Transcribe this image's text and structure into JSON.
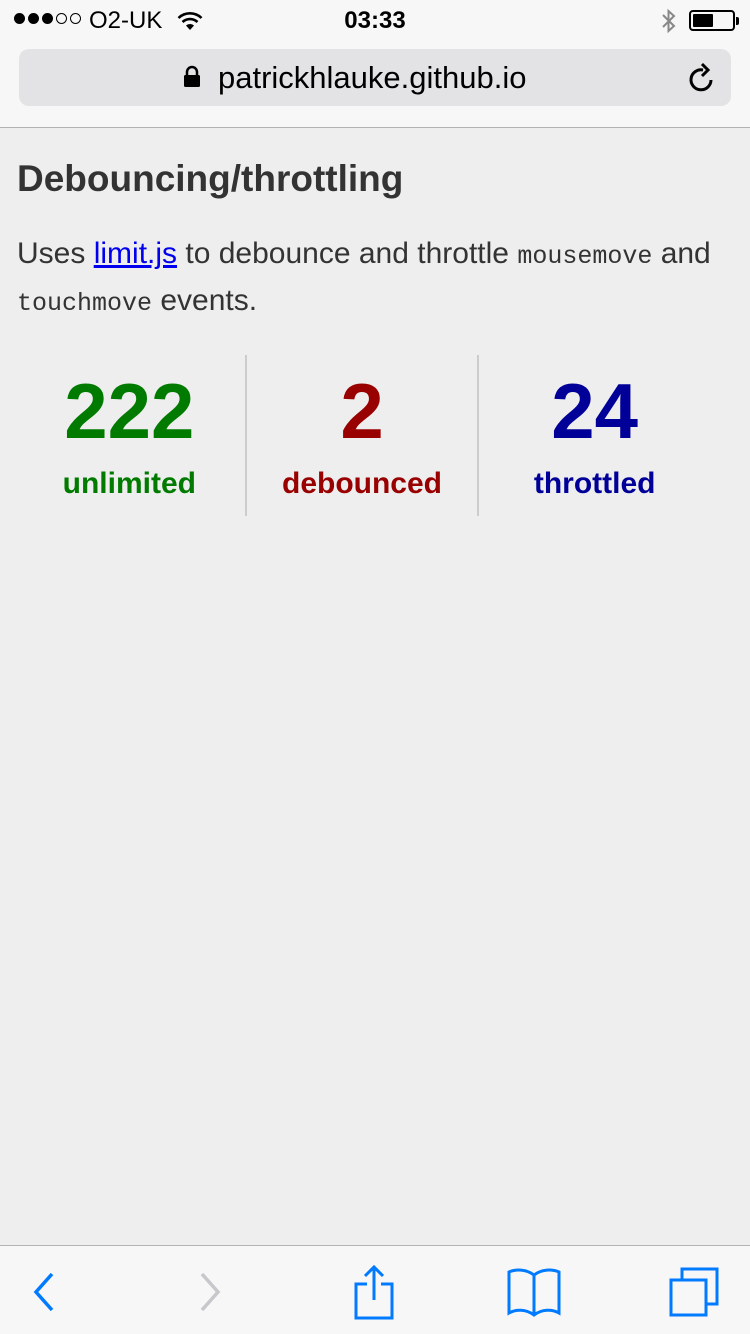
{
  "status_bar": {
    "carrier": "O2-UK",
    "time": "03:33",
    "signal_bars_filled": 3,
    "signal_bars_total": 5,
    "battery_level": 0.45
  },
  "browser": {
    "url": "patrickhlauke.github.io",
    "accent_color": "#007aff"
  },
  "page": {
    "title": "Debouncing/throttling",
    "intro": {
      "prefix": "Uses",
      "link": "limit.js",
      "middle": "to debounce and throttle",
      "code_1": "mousemove",
      "and": "and",
      "code_2": "touchmove",
      "suffix": "events."
    },
    "counters": [
      {
        "value": "222",
        "label": "unlimited",
        "color": "#007b00"
      },
      {
        "value": "2",
        "label": "debounced",
        "color": "#990000"
      },
      {
        "value": "24",
        "label": "throttled",
        "color": "#000099"
      }
    ]
  },
  "toolbar": {
    "icons": [
      "back-icon",
      "forward-icon",
      "share-icon",
      "bookmarks-icon",
      "tabs-icon"
    ]
  }
}
